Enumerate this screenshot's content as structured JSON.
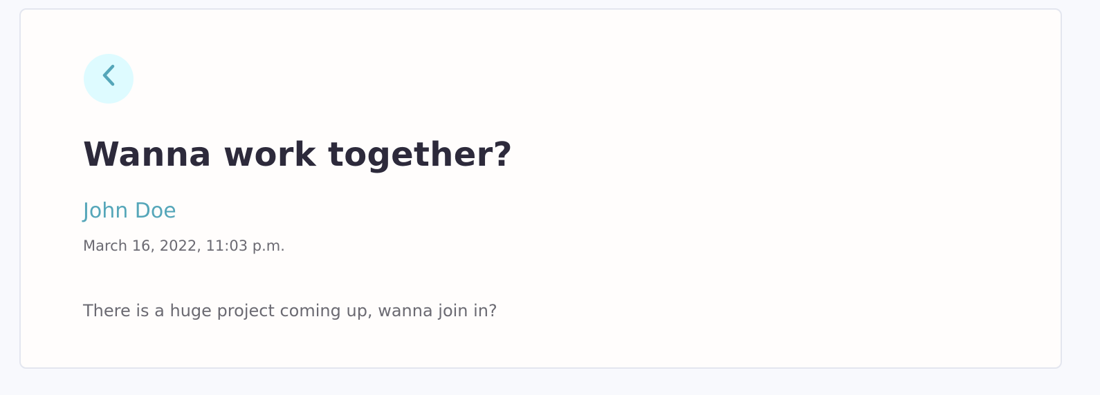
{
  "message": {
    "title": "Wanna work together?",
    "sender": "John Doe",
    "timestamp": "March 16, 2022, 11:03 p.m.",
    "body": "There is a huge project coming up, wanna join in?"
  },
  "back_button": {
    "icon": "chevron-left-icon"
  },
  "colors": {
    "accent": "#55a6b9",
    "back_button_bg": "#defbff",
    "title": "#2d2a3b",
    "muted_text": "#6b6a72",
    "card_bg": "#fffdfc",
    "page_bg": "#f8f9fd",
    "card_border": "#e3e6ef"
  }
}
